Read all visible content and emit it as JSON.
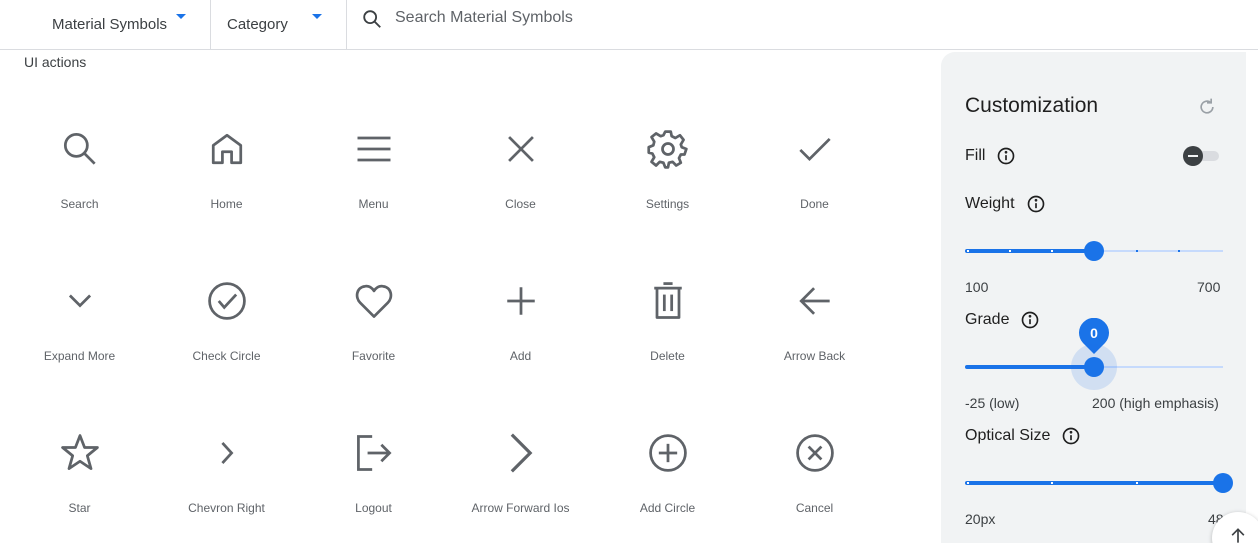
{
  "header": {
    "family_dropdown": "Material Symbols",
    "category_dropdown": "Category",
    "search_placeholder": "Search Material Symbols"
  },
  "section_title": "UI actions",
  "icons": [
    {
      "label": "Search",
      "icon": "search-icon"
    },
    {
      "label": "Home",
      "icon": "home-icon"
    },
    {
      "label": "Menu",
      "icon": "menu-icon"
    },
    {
      "label": "Close",
      "icon": "close-icon"
    },
    {
      "label": "Settings",
      "icon": "settings-icon"
    },
    {
      "label": "Done",
      "icon": "done-icon"
    },
    {
      "label": "Expand More",
      "icon": "expand-more-icon"
    },
    {
      "label": "Check Circle",
      "icon": "check-circle-icon"
    },
    {
      "label": "Favorite",
      "icon": "favorite-icon"
    },
    {
      "label": "Add",
      "icon": "add-icon"
    },
    {
      "label": "Delete",
      "icon": "delete-icon"
    },
    {
      "label": "Arrow Back",
      "icon": "arrow-back-icon"
    },
    {
      "label": "Star",
      "icon": "star-icon"
    },
    {
      "label": "Chevron Right",
      "icon": "chevron-right-icon"
    },
    {
      "label": "Logout",
      "icon": "logout-icon"
    },
    {
      "label": "Arrow Forward Ios",
      "icon": "arrow-forward-ios-icon"
    },
    {
      "label": "Add Circle",
      "icon": "add-circle-icon"
    },
    {
      "label": "Cancel",
      "icon": "cancel-icon"
    }
  ],
  "customization": {
    "title": "Customization",
    "fill": {
      "label": "Fill",
      "enabled": false
    },
    "weight": {
      "label": "Weight",
      "min_label": "100",
      "max_label": "700",
      "value": 400
    },
    "grade": {
      "label": "Grade",
      "min_label": "-25 (low)",
      "max_label": "200 (high emphasis)",
      "value": 0,
      "value_label": "0"
    },
    "optical_size": {
      "label": "Optical Size",
      "min_label": "20px",
      "max_label": "48px",
      "value": 48
    }
  },
  "colors": {
    "accent": "#1a73e8",
    "icon": "#5f6368",
    "panel_bg": "#f1f3f4"
  }
}
